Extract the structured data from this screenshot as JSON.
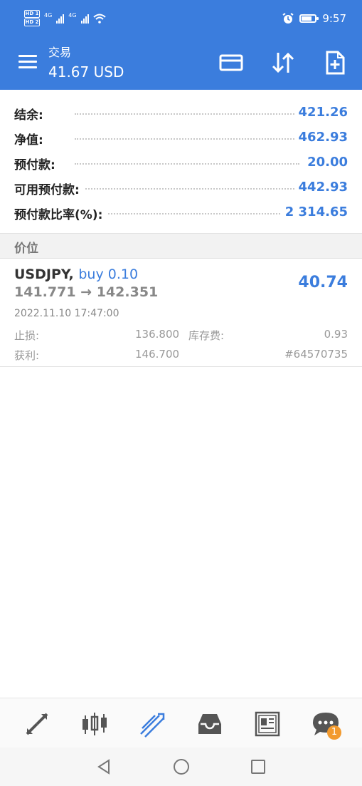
{
  "status_bar": {
    "hd_badges": [
      "HD 1",
      "HD 2"
    ],
    "signal_labels": [
      "4G",
      "4G"
    ],
    "time": "9:57"
  },
  "appbar": {
    "title": "交易",
    "balance": "41.67 USD",
    "icons": [
      "menu-icon",
      "card-icon",
      "sort-icon",
      "new-order-icon"
    ]
  },
  "summary": [
    {
      "label": "结余:",
      "value": "421.26"
    },
    {
      "label": "净值:",
      "value": "462.93"
    },
    {
      "label": "预付款:",
      "value": "20.00"
    },
    {
      "label": "可用预付款:",
      "value": "442.93"
    },
    {
      "label": "预付款比率(%):",
      "value": "2 314.65"
    }
  ],
  "section_header": "价位",
  "position": {
    "symbol": "USDJPY,",
    "side": "buy 0.10",
    "price_open": "141.771",
    "arrow": "→",
    "price_current": "142.351",
    "profit": "40.74",
    "datetime": "2022.11.10 17:47:00",
    "sl_label": "止损:",
    "sl_value": "136.800",
    "swap_label": "库存费:",
    "swap_value": "0.93",
    "tp_label": "获利:",
    "tp_value": "146.700",
    "ticket": "#64570735"
  },
  "bottom_nav": {
    "items": [
      "quotes-icon",
      "chart-icon",
      "trade-icon",
      "history-icon",
      "news-icon",
      "chat-icon"
    ],
    "active": "trade-icon",
    "chat_badge": "1",
    "active_color": "#3b7ddd"
  },
  "colors": {
    "primary": "#3b7ddd",
    "badge": "#f29a2e"
  }
}
